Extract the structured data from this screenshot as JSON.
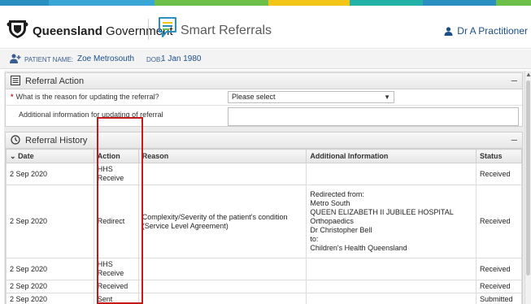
{
  "brand": {
    "qld_bold": "Queensland",
    "qld_rest": " Government",
    "app_title": "Smart Referrals",
    "stripe_colors": [
      "#2a8fc1",
      "#3aa6d6",
      "#6cc04a",
      "#f3c517",
      "#22b2a8",
      "#2a8fc1",
      "#6cc04a"
    ]
  },
  "user": {
    "name": "Dr A Practitioner",
    "icon": "person-icon"
  },
  "patient": {
    "name_label": "Patient name:",
    "name": "Zoe Metrosouth",
    "dob_label": "DOB:",
    "dob": "1 Jan 1980"
  },
  "referral_action": {
    "title": "Referral Action",
    "collapse": "–",
    "reason_question": "What is the reason for updating the referral?",
    "required_marker": "*",
    "reason_select_value": "Please select",
    "additional_info_label": "Additional information for updating of referral",
    "additional_info_value": ""
  },
  "referral_history": {
    "title": "Referral History",
    "collapse": "–",
    "columns": {
      "date": "Date",
      "action": "Action",
      "reason": "Reason",
      "additional": "Additional Information",
      "status": "Status"
    },
    "sort_indicator": "chevron-down-icon",
    "rows": [
      {
        "date": "2 Sep 2020",
        "action": "HHS Receive",
        "reason": "",
        "additional": [],
        "status": "Received"
      },
      {
        "date": "2 Sep 2020",
        "action": "Redirect",
        "reason": "Complexity/Severity of the patient's condition (Service Level Agreement)",
        "additional": [
          "Redirected from:",
          "Metro South",
          "QUEEN ELIZABETH II JUBILEE HOSPITAL",
          "Orthopaedics",
          "Dr Christopher Bell",
          "to:",
          "Children's Health Queensland"
        ],
        "status": "Received"
      },
      {
        "date": "2 Sep 2020",
        "action": "HHS Receive",
        "reason": "",
        "additional": [],
        "status": "Received"
      },
      {
        "date": "2 Sep 2020",
        "action": "Received",
        "reason": "",
        "additional": [],
        "status": "Received"
      },
      {
        "date": "2 Sep 2020",
        "action": "Sent",
        "reason": "",
        "additional": [],
        "status": "Submitted"
      }
    ]
  },
  "highlight_color": "#c41a1a"
}
